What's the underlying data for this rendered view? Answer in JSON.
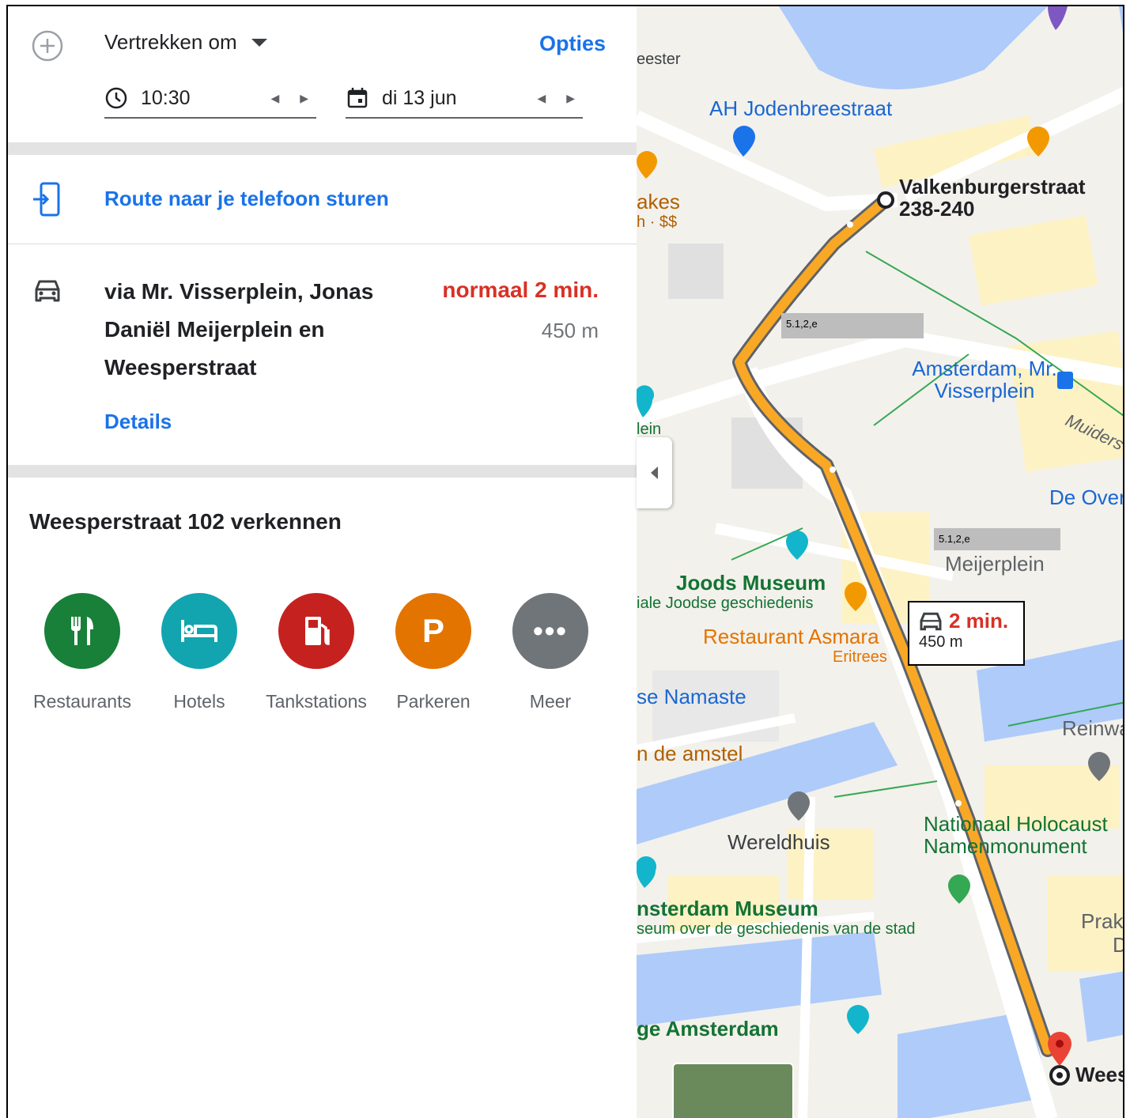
{
  "directions": {
    "depart_label": "Vertrekken om",
    "options_label": "Opties",
    "time_value": "10:30",
    "date_value": "di 13 jun"
  },
  "send": {
    "label": "Route naar je telefoon sturen"
  },
  "route": {
    "via": "via Mr. Visserplein, Jonas Daniël Meijerplein en Weesperstraat",
    "time": "normaal 2 min.",
    "distance": "450 m",
    "details_label": "Details"
  },
  "explore": {
    "title": "Weesperstraat 102 verkennen",
    "categories": [
      {
        "label": "Restaurants",
        "icon": "restaurant-icon",
        "color": "#188038"
      },
      {
        "label": "Hotels",
        "icon": "hotel-icon",
        "color": "#12a4af"
      },
      {
        "label": "Tankstations",
        "icon": "gas-station-icon",
        "color": "#c5221f"
      },
      {
        "label": "Parkeren",
        "icon": "parking-icon",
        "color": "#e37400"
      },
      {
        "label": "Meer",
        "icon": "more-icon",
        "color": "#70757a"
      }
    ]
  },
  "map": {
    "labels": {
      "meester": "eester",
      "ah": "AH Jodenbreestraat",
      "start": "Valkenburgerstraat 238-240",
      "cakes": "akes",
      "cakes_sub": "h · $$",
      "station": "Amsterdam, Mr. Visserplein",
      "muiders": "Muiders",
      "de_over": "De Over",
      "meijerplein": "Meijerplein",
      "joods": "Joods Museum",
      "joods_sub": "iale Joodse geschiedenis",
      "asmara": "Restaurant Asmara",
      "asmara_sub": "Eritrees",
      "namaste": "se Namaste",
      "amstel": "n de amstel",
      "reinw": "Reinwa",
      "wereldhuis": "Wereldhuis",
      "holocaust": "Nationaal Holocaust Namenmonument",
      "amsterdam_museum": "nsterdam Museum",
      "amsterdam_museum_sub": "seum over de geschiedenis van de stad",
      "prak": "Prak",
      "prak_d": "D",
      "ge_amsterdam": "ge Amsterdam",
      "wees": "Wees",
      "lein": "lein"
    },
    "redacted_1": "5.1,2,e",
    "redacted_2": "5.1,2,e",
    "callout_time": "2 min.",
    "callout_distance": "450 m",
    "route_color": "#f9a825"
  }
}
